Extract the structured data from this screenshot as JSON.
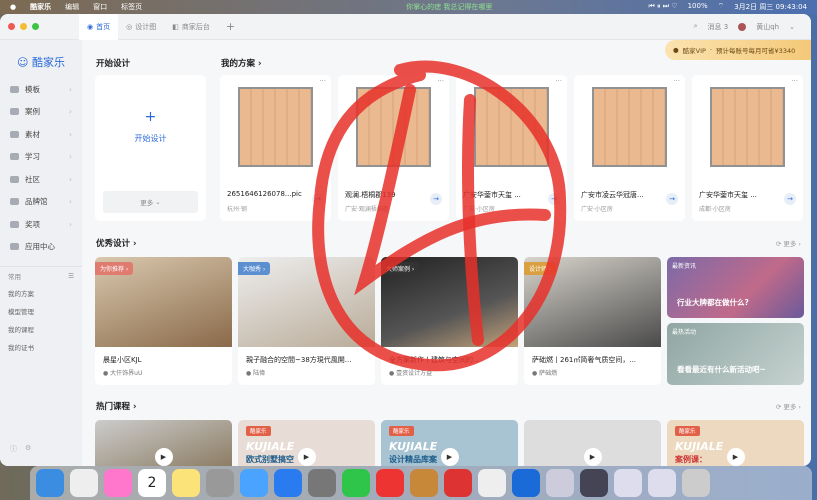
{
  "menubar": {
    "app": "酷家乐",
    "items": [
      "编辑",
      "窗口",
      "标签页"
    ],
    "song": "你掌心的痣 我总记得在哪里",
    "battery": "100%",
    "datetime": "3月2日 周三 09:43:04"
  },
  "tabs": [
    {
      "label": "首页"
    },
    {
      "label": "设计图"
    },
    {
      "label": "商家后台"
    },
    {
      "label": "+"
    }
  ],
  "header": {
    "messages": "消息 3",
    "user": "黄山qh"
  },
  "vip": {
    "label": "酷家VIP",
    "promo": "预计每账号每月可省¥3340"
  },
  "sidebar": {
    "logo": "酷家乐",
    "items": [
      "模板",
      "案例",
      "素材",
      "学习",
      "社区",
      "品牌馆",
      "奖项",
      "应用中心"
    ],
    "common_title": "常用",
    "common": [
      "我的方案",
      "模型管理",
      "我的课程",
      "我的证书"
    ]
  },
  "start": {
    "heading": "开始设计",
    "button": "开始设计",
    "more": "更多"
  },
  "plans": {
    "heading": "我的方案",
    "items": [
      {
        "title": "2651646126078...pic",
        "sub": "杭州·钢"
      },
      {
        "title": "观澜.梧桐郡139",
        "sub": "广安·观澜梧桐郡"
      },
      {
        "title": "广安华蓥市天玺 ...",
        "sub": "广安·小区房"
      },
      {
        "title": "广安市凌云华冠唐...",
        "sub": "广安·小区房"
      },
      {
        "title": "广安华蓥市天玺 ...",
        "sub": "成都·小区房"
      }
    ]
  },
  "designs": {
    "heading": "优秀设计",
    "more": "更多",
    "items": [
      {
        "tag": "为你推荐",
        "title": "晨星小区KJL",
        "author": "大仟饰界uU"
      },
      {
        "tag": "大咖秀",
        "title": "親子融合的空間~38方現代風開...",
        "author": "陆偉"
      },
      {
        "tag": "大师案例",
        "title": "全方案新作丨建筑与空间的...",
        "author": "壹资设计方益"
      },
      {
        "tag": "设计师",
        "title": "萨础燃丨261㎡简奢气质空间，...",
        "author": "萨础燃"
      }
    ]
  },
  "news": [
    {
      "tag": "最新资讯",
      "title": "行业大牌都在做什么?"
    },
    {
      "tag": "最热活动",
      "title": "看看最近有什么新活动吧~"
    }
  ],
  "courses": {
    "heading": "热门课程",
    "more": "更多",
    "items": [
      {
        "logo": "",
        "brand": "",
        "title": ""
      },
      {
        "logo": "酷家乐",
        "brand": "KUJIALE",
        "title": "欧式别墅搞空"
      },
      {
        "logo": "酷家乐",
        "brand": "KUJIALE",
        "title": "设计精品库案"
      },
      {
        "logo": "",
        "brand": "",
        "title": ""
      },
      {
        "logo": "酷家乐",
        "brand": "KUJIALE",
        "title": "案例课："
      }
    ]
  },
  "annotation": "4",
  "colors": {
    "accent": "#2a6ad8",
    "red": "#e8302a"
  }
}
